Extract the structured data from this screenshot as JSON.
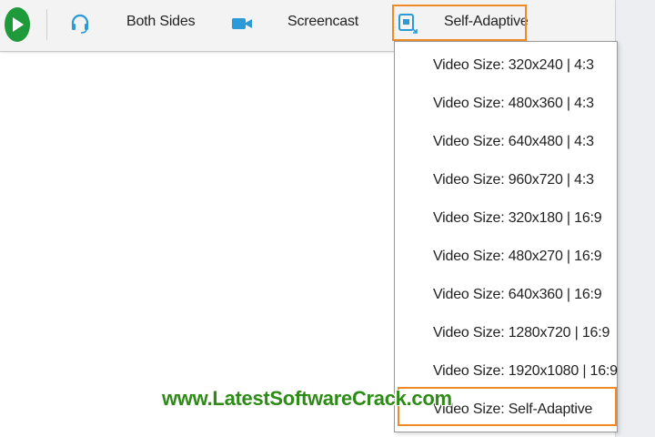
{
  "toolbar": {
    "both_sides_label": "Both Sides",
    "screencast_label": "Screencast",
    "self_adaptive_label": "Self-Adaptive"
  },
  "video_size_menu": {
    "items": [
      "Video Size: 320x240 | 4:3",
      "Video Size: 480x360 | 4:3",
      "Video Size: 640x480 | 4:3",
      "Video Size: 960x720 | 4:3",
      "Video Size: 320x180 | 16:9",
      "Video Size: 480x270 | 16:9",
      "Video Size: 640x360 | 16:9",
      "Video Size: 1280x720 | 16:9",
      "Video Size: 1920x1080 | 16:9",
      "Video Size: Self-Adaptive"
    ],
    "selected": "Video Size: Self-Adaptive"
  },
  "watermark": "www.LatestSoftwareCrack.com",
  "icons": {
    "play": "play-icon",
    "headset": "headset-icon",
    "camera": "video-camera-icon",
    "self_adaptive": "self-adaptive-icon"
  },
  "colors": {
    "accent_highlight": "#f08a24",
    "play_green": "#1e9a3b",
    "icon_blue": "#2a9ad8",
    "watermark_green": "#2e8b17"
  }
}
